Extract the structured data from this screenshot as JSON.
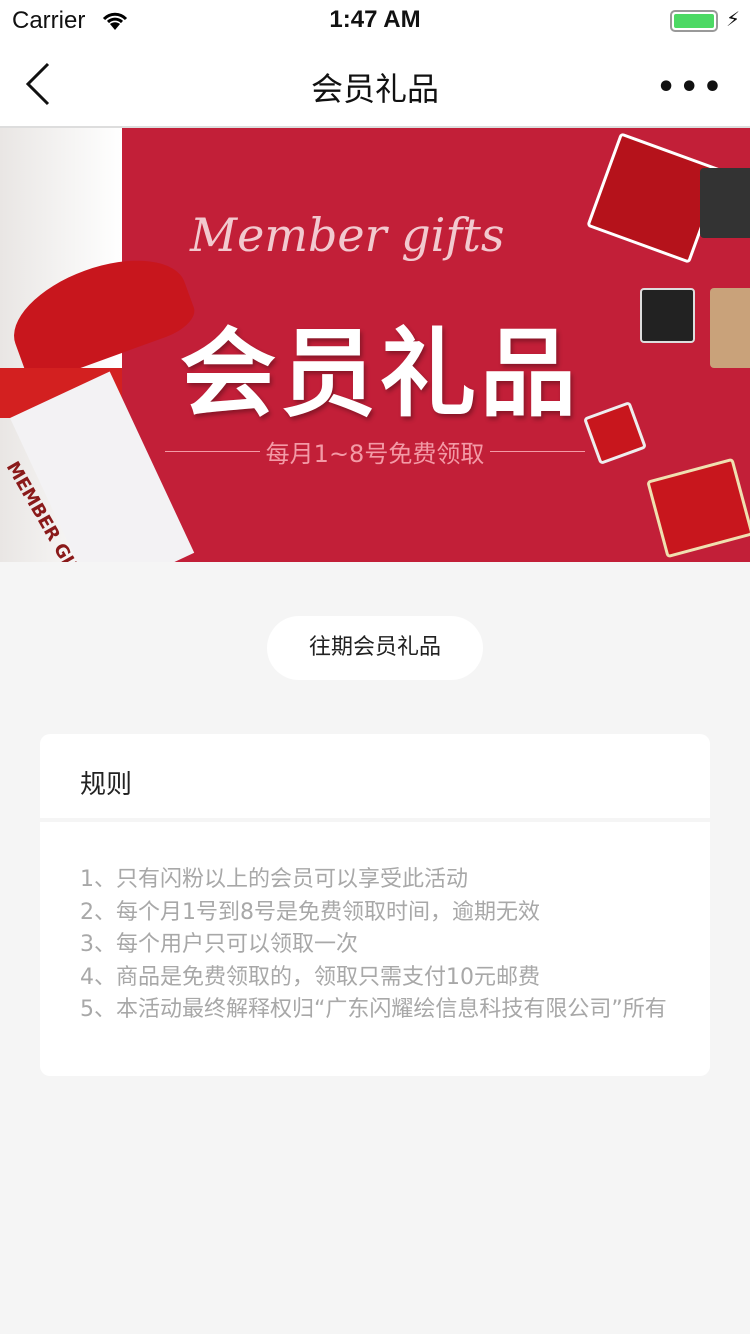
{
  "status_bar": {
    "carrier": "Carrier",
    "time": "1:47 AM"
  },
  "nav": {
    "title": "会员礼品",
    "more": "•••"
  },
  "banner": {
    "script_title": "Member gifts",
    "title": "会员礼品",
    "subtitle": "每月1~8号免费领取",
    "tag_text": "MEMBER GIFTS",
    "color": "#c21f38"
  },
  "past_gifts_button": "往期会员礼品",
  "rules": {
    "heading": "规则",
    "items": [
      "1、只有闪粉以上的会员可以享受此活动",
      "2、每个月1号到8号是免费领取时间，逾期无效",
      "3、每个用户只可以领取一次",
      "4、商品是免费领取的，领取只需支付10元邮费",
      "5、本活动最终解释权归“广东闪耀绘信息科技有限公司”所有"
    ]
  }
}
